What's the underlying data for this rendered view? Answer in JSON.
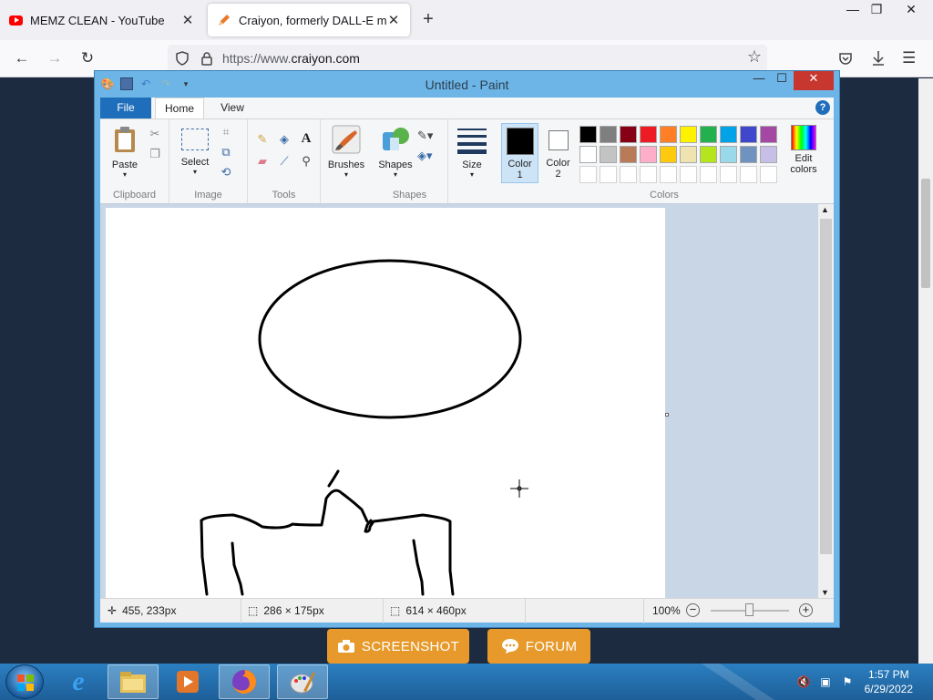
{
  "browser": {
    "tabs": [
      {
        "title": "MEMZ CLEAN - YouTube",
        "icon": "youtube-icon"
      },
      {
        "title": "Craiyon, formerly DALL-E mini",
        "icon": "crayon-icon"
      }
    ],
    "url_prefix": "https://www.",
    "url_domain": "craiyon.com"
  },
  "webpage": {
    "buttons": [
      {
        "label": "SCREENSHOT",
        "icon": "camera-icon"
      },
      {
        "label": "FORUM",
        "icon": "chat-icon"
      }
    ],
    "accent": "#e79a2b",
    "background": "#1c2b40"
  },
  "paint": {
    "title": "Untitled - Paint",
    "ribbon_tabs": {
      "file": "File",
      "home": "Home",
      "view": "View"
    },
    "groups": {
      "clipboard": "Clipboard",
      "image": "Image",
      "tools": "Tools",
      "shapes": "Shapes",
      "colors": "Colors"
    },
    "buttons": {
      "paste": "Paste",
      "select": "Select",
      "brushes": "Brushes",
      "shapes": "Shapes",
      "size": "Size",
      "color1": "Color\n1",
      "color1_line1": "Color",
      "color1_line2": "1",
      "color2_line1": "Color",
      "color2_line2": "2",
      "edit_colors_line1": "Edit",
      "edit_colors_line2": "colors"
    },
    "palette_row1": [
      "#000000",
      "#7f7f7f",
      "#880015",
      "#ed1c24",
      "#ff7f27",
      "#fff200",
      "#22b14c",
      "#00a2e8",
      "#3f48cc",
      "#a349a4"
    ],
    "palette_row2": [
      "#ffffff",
      "#c3c3c3",
      "#b97a57",
      "#ffaec9",
      "#ffc90e",
      "#efe4b0",
      "#b5e61d",
      "#99d9ea",
      "#7092be",
      "#c8bfe7"
    ],
    "color1": "#000000",
    "color2": "#ffffff",
    "status": {
      "cursor": "455, 233px",
      "selection": "286 × 175px",
      "canvas_size": "614 × 460px",
      "zoom": "100%"
    }
  },
  "taskbar": {
    "time": "1:57 PM",
    "date": "6/29/2022",
    "apps": [
      "internet-explorer-icon",
      "file-explorer-icon",
      "media-player-icon",
      "firefox-icon",
      "paint-icon"
    ]
  }
}
